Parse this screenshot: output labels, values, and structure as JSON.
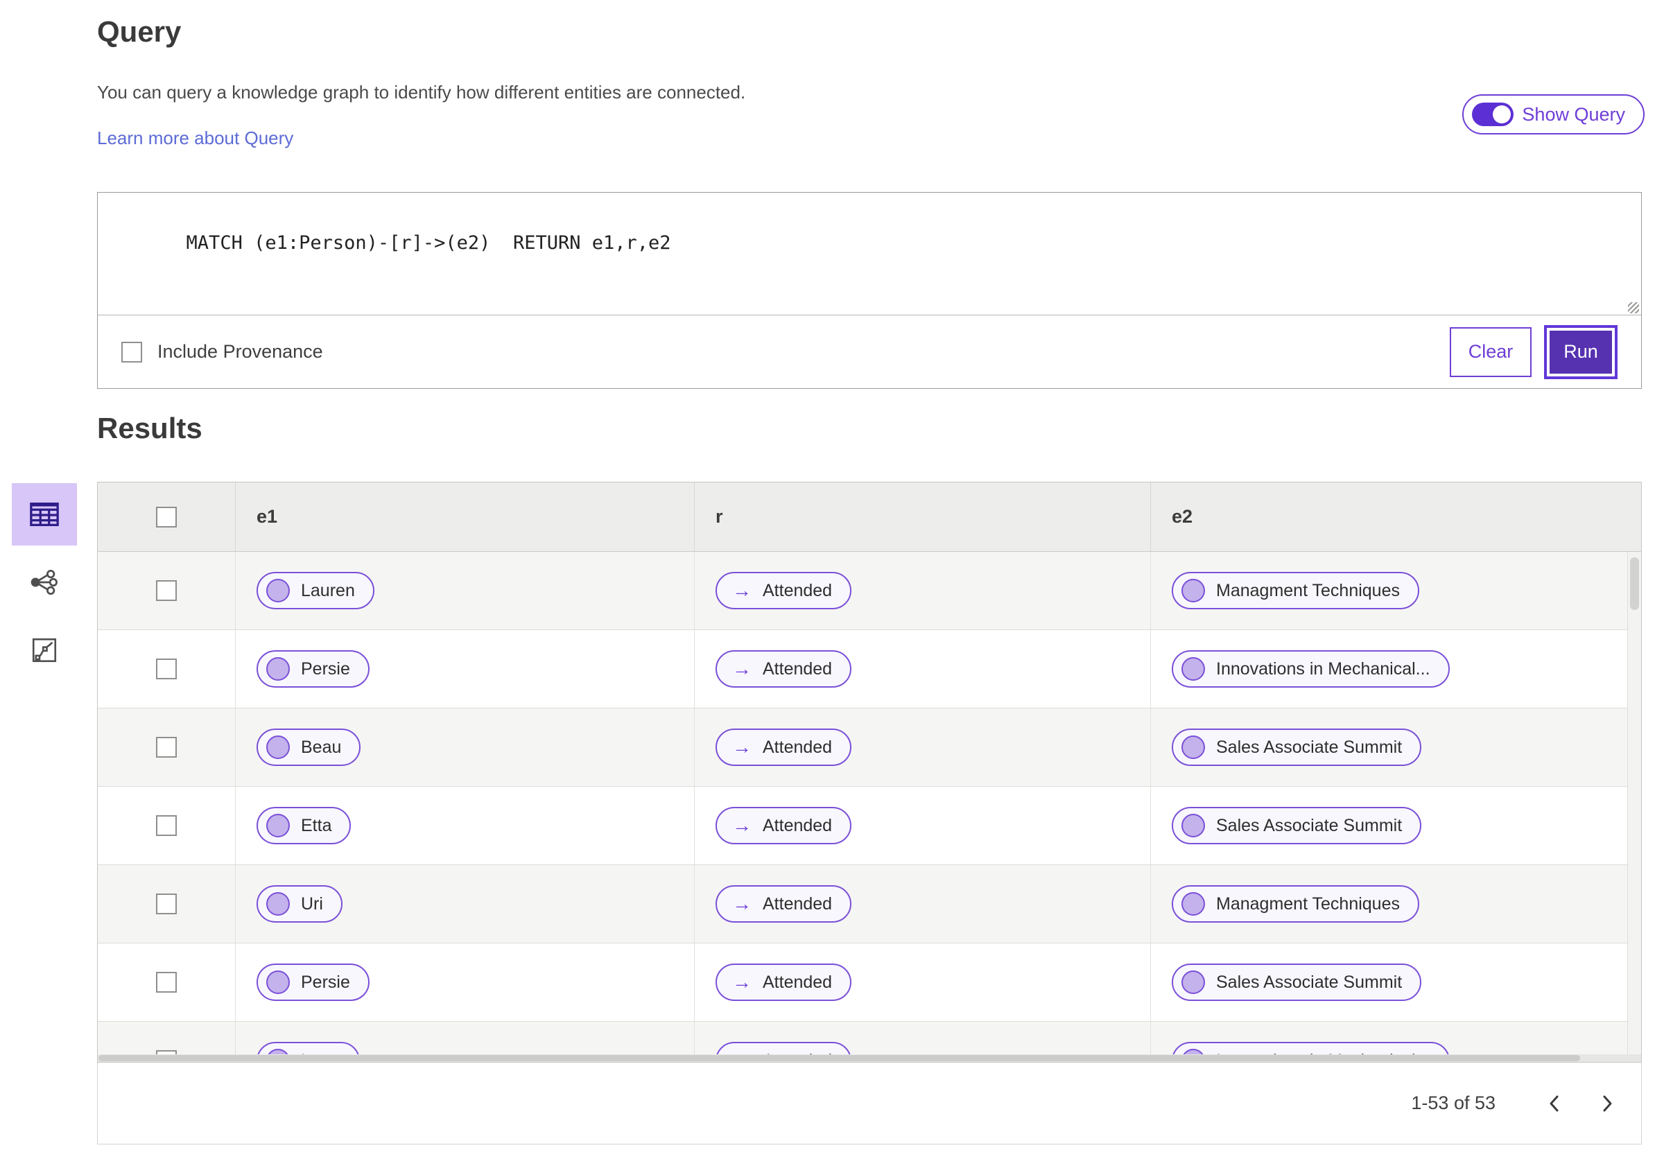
{
  "colors": {
    "accent": "#6e3ed6",
    "accent_deep": "#5632b0",
    "toggle_fill": "#5c2fd4",
    "selected_view_bg": "#d8c6f8",
    "pill_bg": "#f8f7fe",
    "node_fill": "#c4b2ec",
    "link": "#5d6bd6",
    "header_bg": "#ededeb",
    "row_alt_bg": "#f5f5f3"
  },
  "icons": {
    "toggle": "toggle-on-icon",
    "relation_arrow": "→",
    "table_view": "table-icon",
    "graph_view": "network-icon",
    "chart_view": "chart-icon",
    "prev": "chevron-left-icon",
    "next": "chevron-right-icon"
  },
  "query": {
    "title": "Query",
    "description": "You can query a knowledge graph to identify how different entities are connected.",
    "learn_more": "Learn more about Query",
    "show_query": "Show Query",
    "text": "MATCH (e1:Person)-[r]->(e2)  RETURN e1,r,e2",
    "include_provenance": "Include Provenance",
    "clear": "Clear",
    "run": "Run"
  },
  "results": {
    "title": "Results",
    "header": {
      "e1": "e1",
      "r": "r",
      "e2": "e2"
    },
    "rows": [
      {
        "e1": "Lauren",
        "r": "Attended",
        "e2": "Managment Techniques"
      },
      {
        "e1": "Persie",
        "r": "Attended",
        "e2": "Innovations in Mechanical..."
      },
      {
        "e1": "Beau",
        "r": "Attended",
        "e2": "Sales Associate Summit"
      },
      {
        "e1": "Etta",
        "r": "Attended",
        "e2": "Sales Associate Summit"
      },
      {
        "e1": "Uri",
        "r": "Attended",
        "e2": "Managment Techniques"
      },
      {
        "e1": "Persie",
        "r": "Attended",
        "e2": "Sales Associate Summit"
      },
      {
        "e1": "Larry",
        "r": "Attended",
        "e2": "Innovations in Mechanical..."
      }
    ],
    "pagination": "1-53 of 53"
  }
}
